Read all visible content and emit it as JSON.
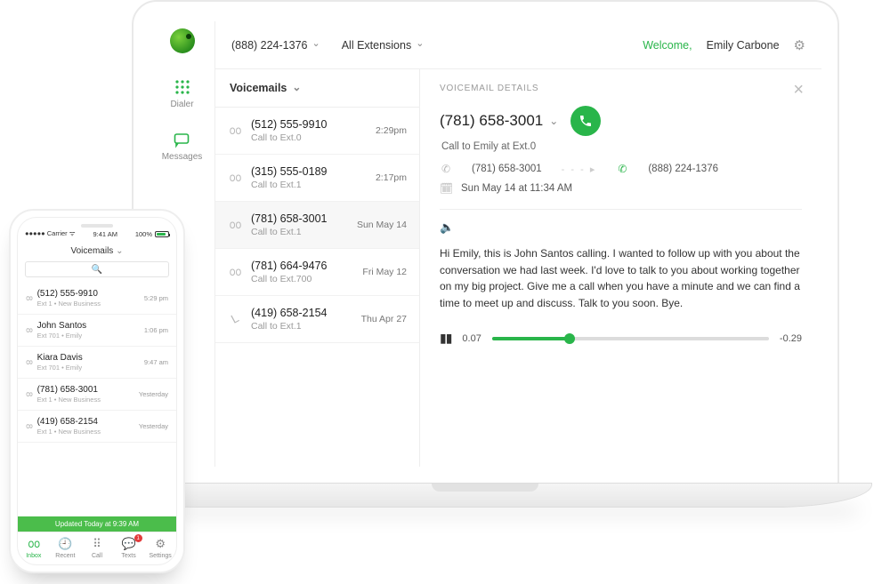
{
  "laptop": {
    "rail": {
      "dialer": "Dialer",
      "messages": "Messages"
    },
    "topbar": {
      "phone": "(888) 224-1376",
      "extensions": "All Extensions",
      "welcome": "Welcome,",
      "user": "Emily Carbone"
    },
    "list": {
      "title": "Voicemails",
      "items": [
        {
          "num": "(512) 555-9910",
          "sub": "Call to Ext.0",
          "time": "2:29pm"
        },
        {
          "num": "(315) 555-0189",
          "sub": "Call to Ext.1",
          "time": "2:17pm"
        },
        {
          "num": "(781) 658-3001",
          "sub": "Call to Ext.1",
          "time": "Sun May 14"
        },
        {
          "num": "(781) 664-9476",
          "sub": "Call to Ext.700",
          "time": "Fri May 12"
        },
        {
          "num": "(419) 658-2154",
          "sub": "Call to Ext.1",
          "time": "Thu Apr 27"
        }
      ]
    },
    "detail": {
      "title": "VOICEMAIL DETAILS",
      "phone": "(781) 658-3001",
      "sub": "Call to Emily at Ext.0",
      "from": "(781) 658-3001",
      "to": "(888) 224-1376",
      "date": "Sun May 14 at 11:34 AM",
      "transcript": "Hi Emily, this is John Santos calling. I wanted to follow up with you about the conversation we had last week. I'd love to talk to you about working together on my big project. Give me a call when you have a minute and we can find a time to meet up and discuss. Talk to you soon. Bye.",
      "elapsed": "0.07",
      "remain": "-0.29"
    }
  },
  "phone": {
    "carrier": "Carrier",
    "clock": "9:41 AM",
    "battery": "100%",
    "head": "Voicemails",
    "list": [
      {
        "n": "(512) 555-9910",
        "s": "Ext 1 • New Business",
        "t": "5:29 pm"
      },
      {
        "n": "John Santos",
        "s": "Ext 701 • Emily",
        "t": "1:06 pm"
      },
      {
        "n": "Kiara Davis",
        "s": "Ext 701 • Emily",
        "t": "9:47 am"
      },
      {
        "n": "(781) 658-3001",
        "s": "Ext 1 • New Business",
        "t": "Yesterday"
      },
      {
        "n": "(419) 658-2154",
        "s": "Ext 1 • New Business",
        "t": "Yesterday"
      }
    ],
    "update": "Updated Today at 9:39 AM",
    "tabs": {
      "inbox": "Inbox",
      "recent": "Recent",
      "call": "Call",
      "texts": "Texts",
      "settings": "Settings",
      "badge": "1"
    }
  }
}
